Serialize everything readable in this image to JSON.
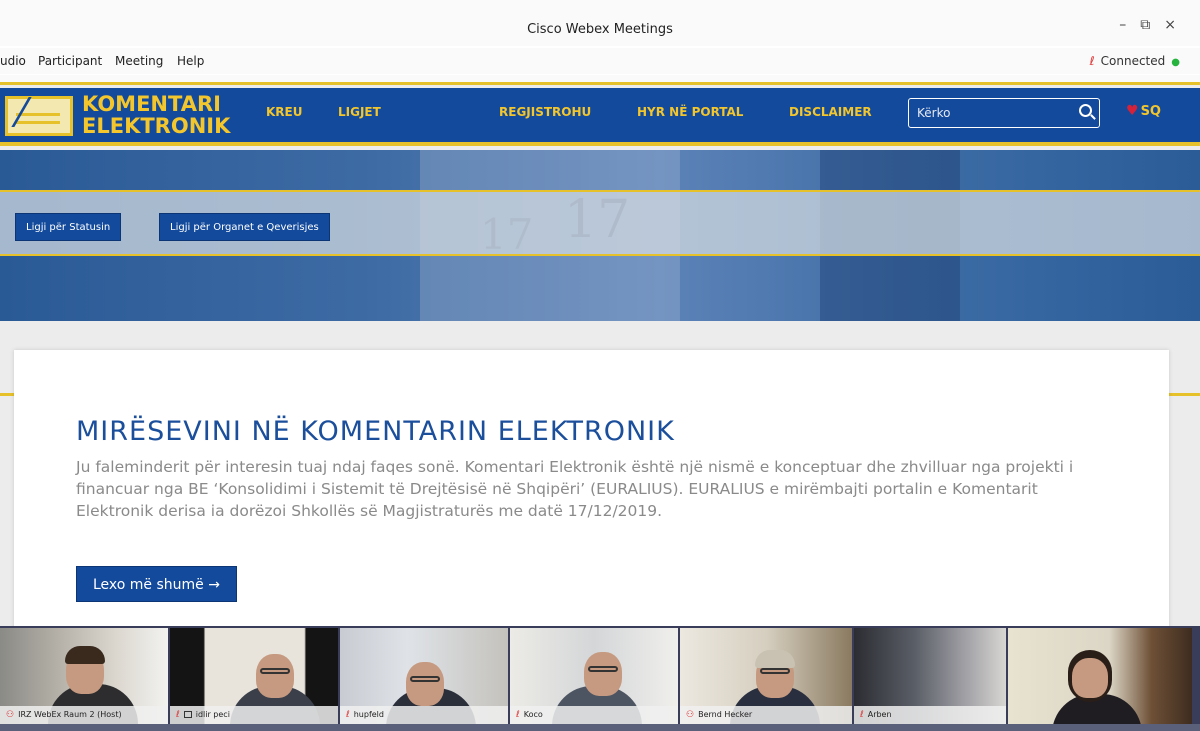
{
  "window": {
    "title": "Cisco Webex Meetings",
    "controls": [
      "–",
      "⧉",
      "×"
    ]
  },
  "menu": {
    "items": [
      "udio",
      "Participant",
      "Meeting",
      "Help"
    ],
    "status": "Connected"
  },
  "site": {
    "brand_line1": "KOMENTARI",
    "brand_line2": "ELEKTRONIK",
    "nav": [
      "KREU",
      "LIGJET",
      "REGJISTROHU",
      "HYR NË PORTAL",
      "DISCLAIMER"
    ],
    "search_placeholder": "Kërko",
    "language": "SQ",
    "law_buttons": [
      "Ligji për Statusin",
      "Ligji për Organet e Qeverisjes"
    ],
    "hero_numbers": [
      "17",
      "17"
    ],
    "welcome_title": "MIRËSEVINI NË KOMENTARIN ELEKTRONIK",
    "welcome_text": "Ju faleminderit për interesin tuaj ndaj faqes sonë. Komentari Elektronik është një nismë e konceptuar dhe zhvilluar nga projekti i financuar nga BE ‘Konsolidimi i Sistemit të Drejtësisë në Shqipëri’ (EURALIUS). EURALIUS e mirëmbajti portalin e Komentarit Elektronik derisa ia dorëzoi Shkollës së Magjistraturës me datë 17/12/2019.",
    "read_more": "Lexo më shumë →"
  },
  "participants": [
    {
      "name": "IRZ WebEx Raum 2 (Host)"
    },
    {
      "name": "idlir peci"
    },
    {
      "name": "hupfeld"
    },
    {
      "name": "Koco"
    },
    {
      "name": "Bernd Hecker"
    },
    {
      "name": "Arben"
    },
    {
      "name": ""
    }
  ],
  "colors": {
    "site_blue": "#134a9c",
    "brand_yellow": "#f2c62c",
    "connected_dot": "#27b43e"
  }
}
